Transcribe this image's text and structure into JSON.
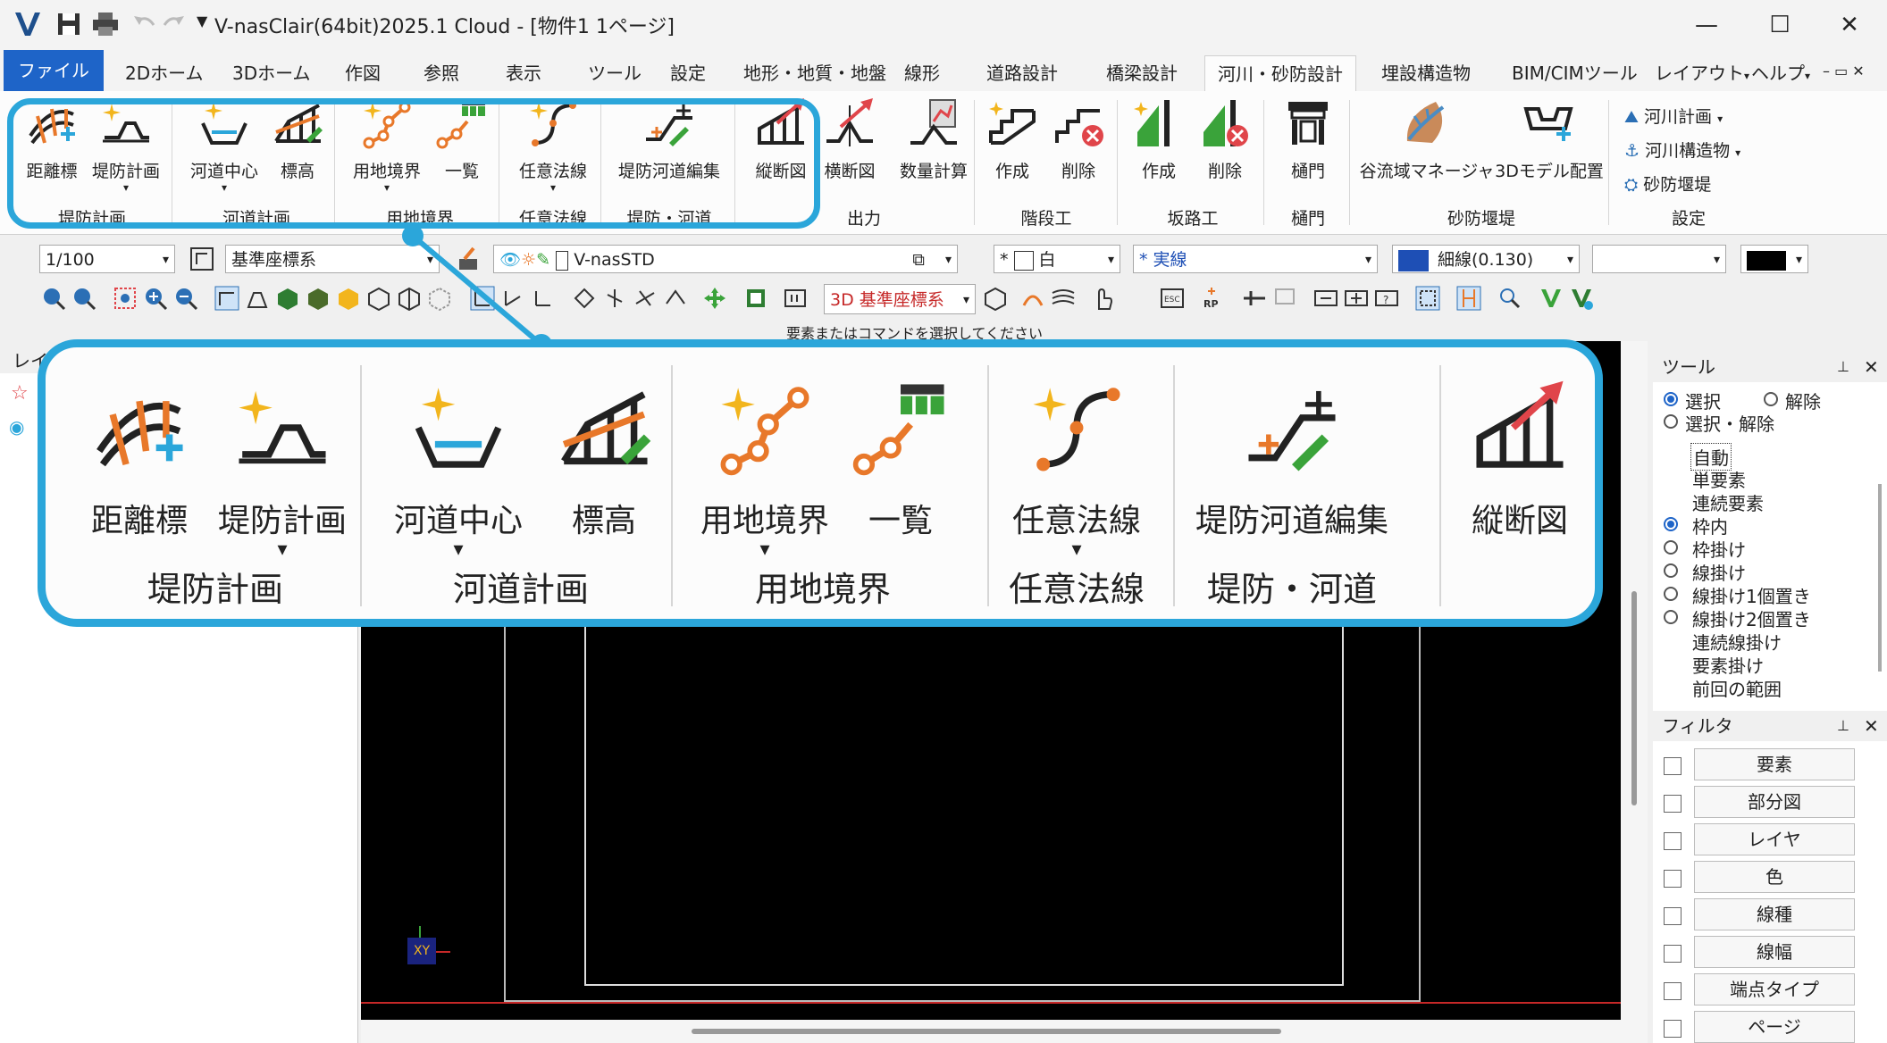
{
  "title": "V-nasClair(64bit)2025.1 Cloud - [物件1 1ページ]",
  "window_controls": {
    "minimize": "—",
    "maximize": "☐",
    "close": "✕"
  },
  "menu": {
    "file": "ファイル",
    "tabs": [
      "2Dホーム",
      "3Dホーム",
      "作図",
      "参照",
      "表示",
      "ツール",
      "設定",
      "地形・地質・地盤",
      "線形",
      "道路設計",
      "橋梁設計",
      "河川・砂防設計",
      "埋設構造物",
      "BIM/CIMツール",
      "レイアウト",
      "ヘルプ"
    ],
    "tab_arrow": "▾"
  },
  "ribbon": {
    "buttons": {
      "kyorihyo": "距離標",
      "teibo_keikaku": "堤防計画",
      "kado_chushin": "河道中心",
      "hyoko": "標高",
      "yochi_kyokai": "用地境界",
      "ichiran": "一覧",
      "nini_hosen": "任意法線",
      "teibo_kado_henshu": "堤防河道編集",
      "judanzu": "縦断図",
      "odanzu": "横断図",
      "suryo_keisan": "数量計算",
      "kaidan_sakusei": "作成",
      "kaidan_sakujo": "削除",
      "hanro_sakusei": "作成",
      "hanro_sakujo": "削除",
      "himon": "樋門",
      "keiryu_manager": "谷流域マネージャ",
      "model_haichi": "3Dモデル配置",
      "kasen_keikaku": "河川計画",
      "kasen_kozobutsu": "河川構造物",
      "sabo_entei": "砂防堰堤"
    },
    "groups": {
      "teibo_keikaku": "堤防計画",
      "kado_keikaku": "河道計画",
      "yochi_kyokai": "用地境界",
      "nini_hosen": "任意法線",
      "teibo_kado": "堤防・河道",
      "shutsuryoku": "出力",
      "kaidanko": "階段工",
      "hanroko": "坂路工",
      "himon": "樋門",
      "sabo_entei": "砂防堰堤",
      "settei": "設定"
    },
    "dropdown_arrow": "▾"
  },
  "toolbar1": {
    "scale": "1/100",
    "coord_system": "基準座標系",
    "layer_name": "V-nasSTD",
    "color_prefix": "*",
    "color": "白",
    "line_type_prefix": "*",
    "line_type": "実線",
    "line_width": "細線(0.130)",
    "dropdown_arrow": "▾"
  },
  "toolbar2": {
    "coord_3d": "3D 基準座標系"
  },
  "status_message": "要素またはコマンドを選択してください",
  "left_panel": {
    "title": "レイ"
  },
  "canvas": {
    "axis_label": "XY"
  },
  "tool_panel": {
    "title": "ツール",
    "select": "選択",
    "release": "解除",
    "select_release": "選択・解除",
    "modes": [
      "自動",
      "単要素",
      "連続要素",
      "枠内",
      "枠掛け",
      "線掛け",
      "線掛け1個置き",
      "線掛け2個置き",
      "連続線掛け",
      "要素掛け",
      "前回の範囲"
    ]
  },
  "filter_panel": {
    "title": "フィルタ",
    "items": [
      "要素",
      "部分図",
      "レイヤ",
      "色",
      "線種",
      "線幅",
      "端点タイプ",
      "ページ"
    ]
  },
  "panel_controls": {
    "pin": "📌",
    "close": "✕"
  },
  "colors": {
    "callout": "#2ba6da",
    "file_tab": "#1e64c8",
    "orange": "#e8782a",
    "green": "#3aa33a",
    "gold": "#f2b51d",
    "red": "#e0454a"
  }
}
